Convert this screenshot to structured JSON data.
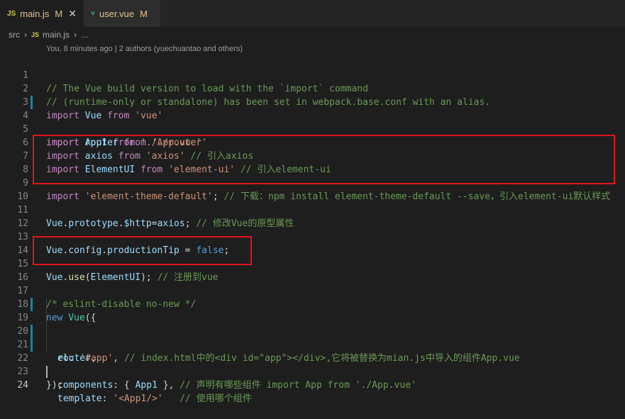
{
  "tabs": [
    {
      "icon": "JS",
      "label": "main.js",
      "status": "M",
      "close": "✕"
    },
    {
      "label": "user.vue",
      "status": "M"
    }
  ],
  "breadcrumb": {
    "root": "src",
    "icon": "JS",
    "file": "main.js",
    "more": "..."
  },
  "blame": "You, 8 minutes ago | 2 authors (yuechuantao and others)",
  "colors": {
    "annotation": "#e0141e",
    "gutter_modified": "#1b81a8"
  },
  "code": {
    "line_numbers": [
      "1",
      "2",
      "3",
      "4",
      "5",
      "6",
      "7",
      "8",
      "9",
      "10",
      "11",
      "12",
      "13",
      "14",
      "15",
      "16",
      "17",
      "18",
      "19",
      "20",
      "21",
      "22",
      "23",
      "24"
    ],
    "l1": "// The Vue build version to load with the `import` command",
    "l2": "// (runtime-only or standalone) has been set in webpack.base.conf with an alias.",
    "l3": {
      "kw": "import",
      "id": "Vue",
      "from": "from",
      "str": "'vue'"
    },
    "l4": {
      "kw": "import",
      "id": "App1",
      "from": "from",
      "str": "'./App.vue'"
    },
    "l5": {
      "kw": "import",
      "id": "router",
      "from": "from",
      "str": "'./router'"
    },
    "l6": {
      "kw": "import",
      "id": "axios",
      "from": "from",
      "str": "'axios'",
      "cmt": "// 引入axios"
    },
    "l7": {
      "kw": "import",
      "id": "ElementUI",
      "from": "from",
      "str": "'element-ui'",
      "cmt": "// 引入element-ui"
    },
    "l9": {
      "kw": "import",
      "str": "'element-theme-default'",
      "punct": ";",
      "cmt": "// 下载：npm install element-theme-default --save，引入element-ui默认样式"
    },
    "l11": {
      "obj": "Vue",
      "dot1": ".",
      "prop1": "prototype",
      "dot2": ".",
      "prop2": "$http",
      "eq": "=",
      "val": "axios",
      "semi": ";",
      "cmt": "// 修改Vue的原型属性"
    },
    "l13": {
      "obj": "Vue",
      "dot1": ".",
      "prop1": "config",
      "dot2": ".",
      "prop2": "productionTip",
      "eq": " = ",
      "val": "false",
      "semi": ";"
    },
    "l15": {
      "obj": "Vue",
      "dot": ".",
      "fn": "use",
      "open": "(",
      "arg": "ElementUI",
      "close": ");",
      "cmt": "// 注册到vue"
    },
    "l17": "/* eslint-disable no-new */",
    "l18": {
      "kw": "new",
      "cls": "Vue",
      "rest": "({"
    },
    "l19": {
      "key": "el",
      "colon": ": ",
      "str": "'#app'",
      "comma": ",",
      "cmt": "// index.html中的<div id=\"app\"></div>,它将被替换为mian.js中导入的组件App.vue"
    },
    "l20": {
      "key": "router",
      "comma": ","
    },
    "l21": {
      "key": "components",
      "mid": ": { ",
      "val": "App1",
      "end": " },",
      "cmt": "// 声明有哪些组件 import App from './App.vue'"
    },
    "l22": {
      "key": "template",
      "colon": ": ",
      "str": "'<App1/>'",
      "cmt": "// 使用哪个组件"
    },
    "l23": "});"
  }
}
